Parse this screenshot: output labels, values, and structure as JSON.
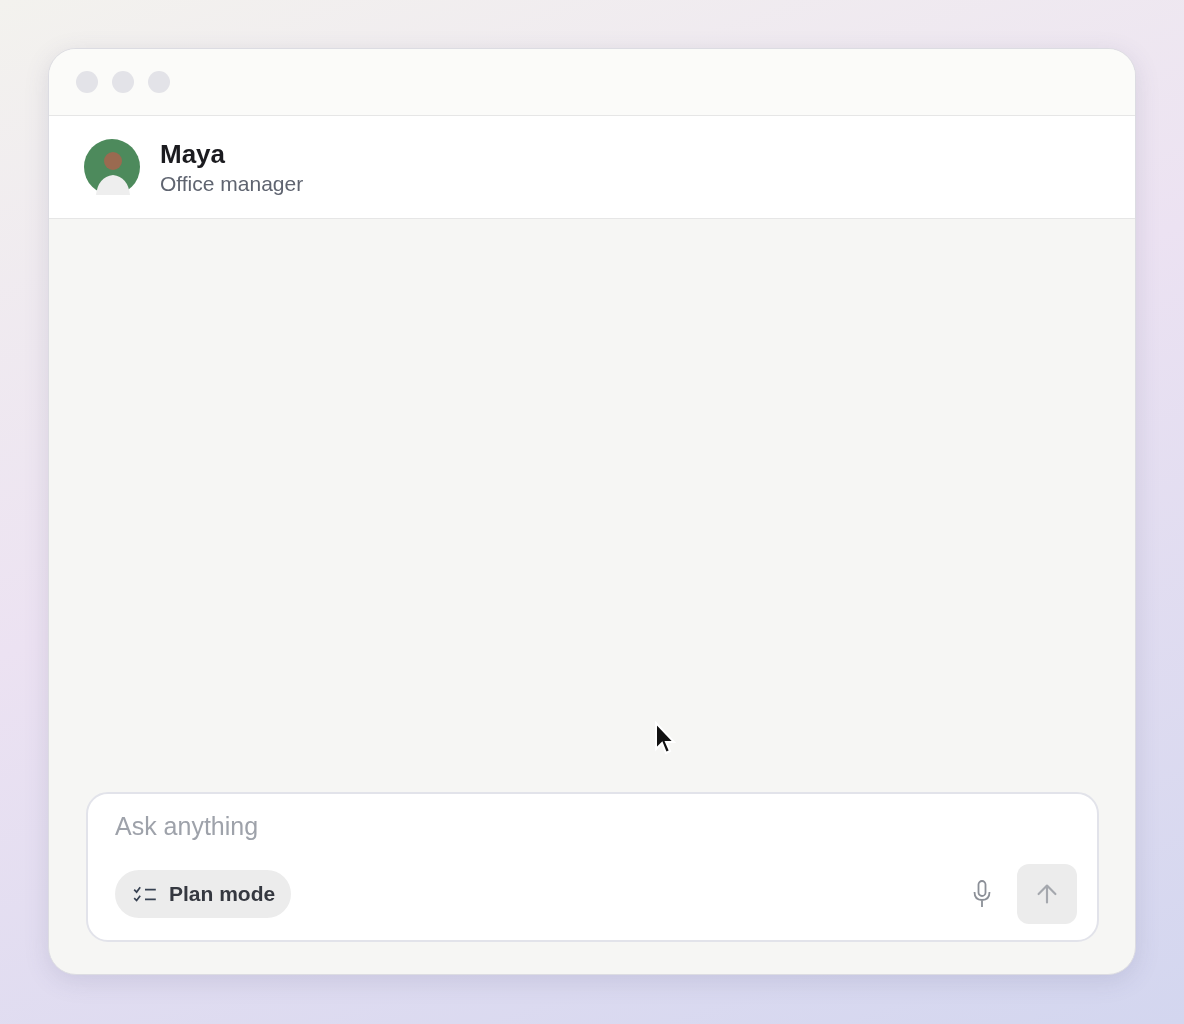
{
  "contact": {
    "name": "Maya",
    "role": "Office manager"
  },
  "composer": {
    "placeholder": "Ask anything",
    "mode_button": {
      "label": "Plan mode"
    },
    "send_button": {
      "disabled": true
    }
  }
}
